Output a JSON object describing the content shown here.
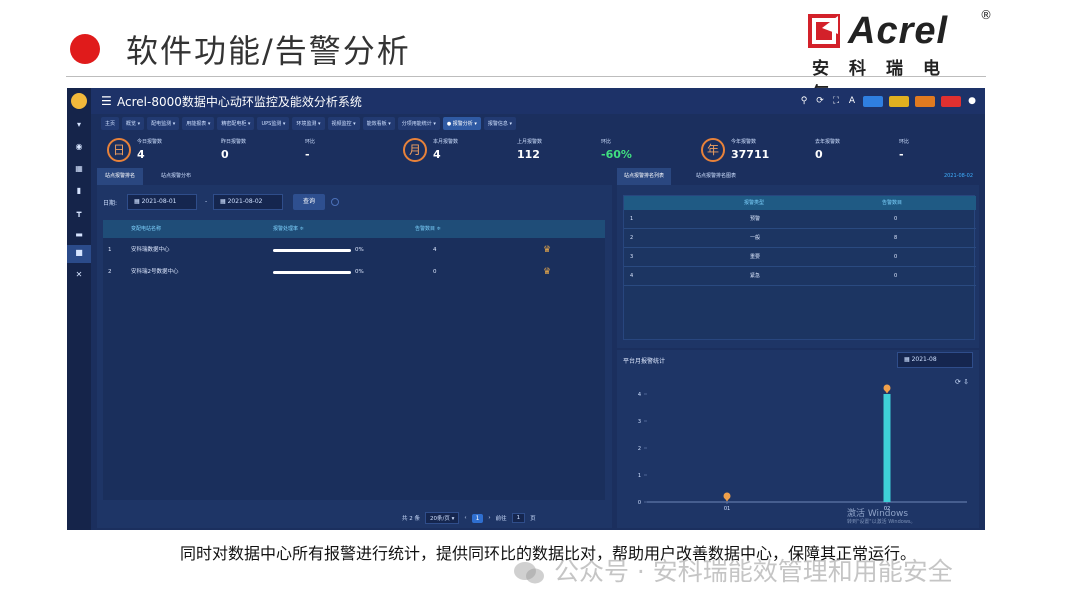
{
  "slide": {
    "title": "软件功能/告警分析",
    "logo_text": "Acrel",
    "logo_reg": "®",
    "logo_cn": "安科瑞电气",
    "caption": "同时对数据中心所有报警进行统计，提供同环比的数据比对，帮助用户改善数据中心，保障其正常运行。",
    "wechat_watermark": "公众号 · 安科瑞能效管理和用能安全"
  },
  "app": {
    "title": "Acrel-8000数据中心动环监控及能效分析系统",
    "nav_tabs": [
      {
        "label": "主页",
        "active": false
      },
      {
        "label": "概览 ▾",
        "active": false
      },
      {
        "label": "配电监测 ▾",
        "active": false
      },
      {
        "label": "用能报表 ▾",
        "active": false
      },
      {
        "label": "精密配电柜 ▾",
        "active": false
      },
      {
        "label": "UPS监测 ▾",
        "active": false
      },
      {
        "label": "环境监测 ▾",
        "active": false
      },
      {
        "label": "视频监控 ▾",
        "active": false
      },
      {
        "label": "能效看板 ▾",
        "active": false
      },
      {
        "label": "分项用能统计 ▾",
        "active": false
      },
      {
        "label": "● 报警分析 ▾",
        "active": true
      },
      {
        "label": "报警信息 ▾",
        "active": false
      }
    ],
    "stats": {
      "day_icon": "日",
      "today_label": "今日报警数",
      "today_value": "4",
      "yesterday_label": "昨日报警数",
      "yesterday_value": "0",
      "day_ratio_label": "环比",
      "day_ratio_value": "-",
      "month_icon": "月",
      "month_label": "本月报警数",
      "month_value": "4",
      "last_month_label": "上月报警数",
      "last_month_value": "112",
      "month_ratio_label": "环比",
      "month_ratio_value": "-60%",
      "year_icon": "年",
      "year_label": "今年报警数",
      "year_value": "37711",
      "last_year_label": "去年报警数",
      "last_year_value": "0",
      "year_ratio_label": "环比",
      "year_ratio_value": "-"
    },
    "left_panel": {
      "tabs": [
        "站点报警排名",
        "站点报警分布"
      ],
      "date_label": "日期:",
      "date_from": "2021-08-01",
      "date_sep": "-",
      "date_to": "2021-08-02",
      "query_label": "查询",
      "headers": [
        "",
        "变配电站名称",
        "报警处理率 ≑",
        "告警数目 ≑",
        ""
      ],
      "rows": [
        {
          "idx": "1",
          "name": "安科瑞数据中心",
          "rate_pct": "0%",
          "rate": 0,
          "count": "4"
        },
        {
          "idx": "2",
          "name": "安科瑞2号数据中心",
          "rate_pct": "0%",
          "rate": 0,
          "count": "0"
        }
      ],
      "pager": {
        "total": "共 2 条",
        "page_size": "20条/页 ▾",
        "prev": "‹",
        "current": "1",
        "next": "›",
        "goto_label": "前往",
        "goto_value": "1",
        "page_unit": "页"
      }
    },
    "right_panel": {
      "tabs": [
        "站点报警排名列表",
        "站点报警排名图表"
      ],
      "date": "2021-08-02",
      "headers": [
        "",
        "报警类型",
        "告警数目"
      ],
      "rows": [
        {
          "idx": "1",
          "type": "预警",
          "count": "0"
        },
        {
          "idx": "2",
          "type": "一般",
          "count": "8"
        },
        {
          "idx": "3",
          "type": "重要",
          "count": "0"
        },
        {
          "idx": "4",
          "type": "紧急",
          "count": "0"
        }
      ]
    },
    "chart_panel": {
      "title": "平台月报警统计",
      "month": "2021-08",
      "watermark": "激活 Windows",
      "watermark_sub": "转到\"设置\"以激活 Windows。"
    }
  },
  "chart_data": {
    "type": "bar",
    "categories": [
      "01",
      "02"
    ],
    "values": [
      0,
      4
    ],
    "ylim": [
      0,
      4
    ],
    "yticks": [
      "0",
      "1",
      "2",
      "3",
      "4"
    ],
    "bar_color": "#3fd0d8",
    "marker_color": "#f0a04b",
    "grid": false
  },
  "colors": {
    "app_bg": "#1b2f5e",
    "topbar": "#1d3268",
    "accent_orange": "#e8823a",
    "positive_green": "#40e080",
    "link_blue": "#3fb0ff"
  },
  "icons": {
    "menu": "☰",
    "search": "⚲",
    "refresh": "⟳",
    "fullscreen": "⛶",
    "user": "●",
    "calendar": "▦",
    "crown": "♛"
  }
}
